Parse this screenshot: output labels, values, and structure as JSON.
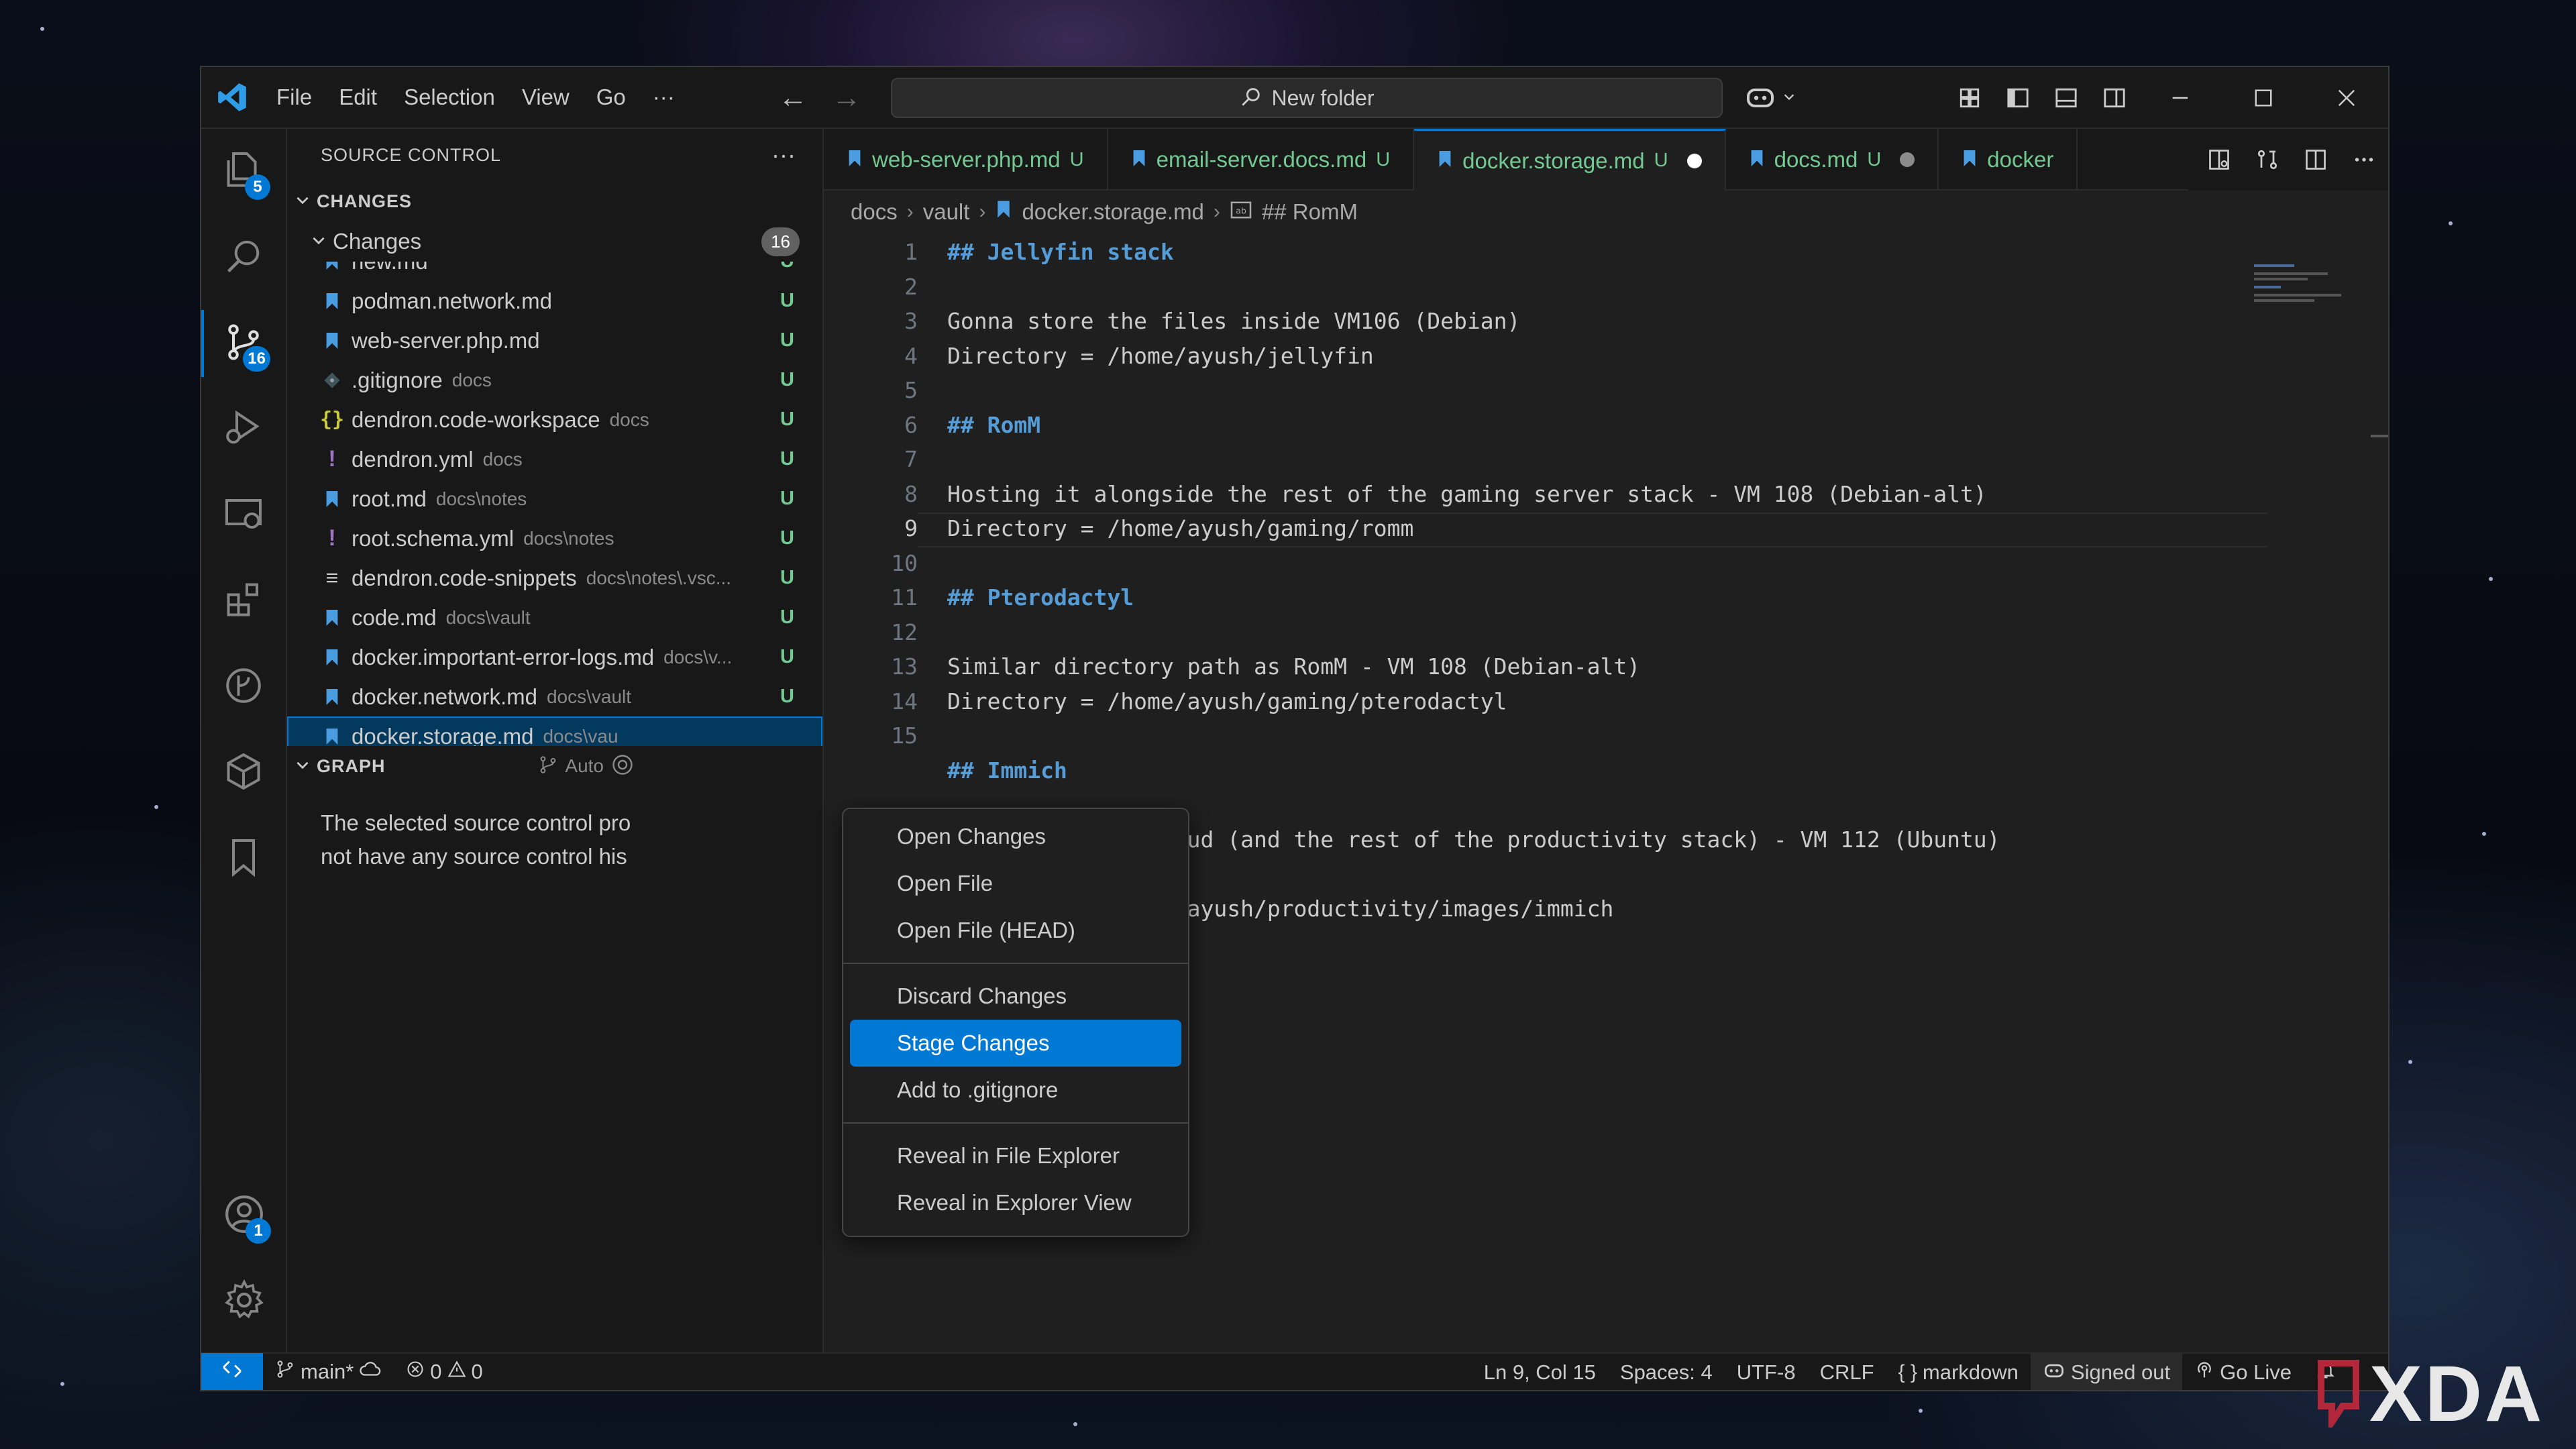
{
  "window": {
    "menu": [
      "File",
      "Edit",
      "Selection",
      "View",
      "Go",
      "···"
    ],
    "nav_back": "←",
    "nav_forward": "→",
    "command_center": "New folder"
  },
  "activity_bar": {
    "explorer_badge": "5",
    "scm_badge": "16",
    "accounts_badge": "1",
    "active": "source-control"
  },
  "sidebar": {
    "title": "SOURCE CONTROL",
    "more": "···",
    "section_changes": "CHANGES",
    "group_label": "Changes",
    "group_count": "16",
    "files": [
      {
        "name": "new.md",
        "path": "",
        "status": "U",
        "icon": "markdown-icon"
      },
      {
        "name": "podman.network.md",
        "path": "",
        "status": "U",
        "icon": "markdown-icon"
      },
      {
        "name": "web-server.php.md",
        "path": "",
        "status": "U",
        "icon": "markdown-icon"
      },
      {
        "name": ".gitignore",
        "path": "docs",
        "status": "U",
        "icon": "git-icon"
      },
      {
        "name": "dendron.code-workspace",
        "path": "docs",
        "status": "U",
        "icon": "json-icon"
      },
      {
        "name": "dendron.yml",
        "path": "docs",
        "status": "U",
        "icon": "yaml-icon"
      },
      {
        "name": "root.md",
        "path": "docs\\notes",
        "status": "U",
        "icon": "markdown-icon"
      },
      {
        "name": "root.schema.yml",
        "path": "docs\\notes",
        "status": "U",
        "icon": "yaml-icon"
      },
      {
        "name": "dendron.code-snippets",
        "path": "docs\\notes\\.vsc...",
        "status": "U",
        "icon": "snippet-icon"
      },
      {
        "name": "code.md",
        "path": "docs\\vault",
        "status": "U",
        "icon": "markdown-icon"
      },
      {
        "name": "docker.important-error-logs.md",
        "path": "docs\\v...",
        "status": "U",
        "icon": "markdown-icon"
      },
      {
        "name": "docker.network.md",
        "path": "docs\\vault",
        "status": "U",
        "icon": "markdown-icon"
      },
      {
        "name": "docker.storage.md",
        "path": "docs\\vau",
        "status": "",
        "icon": "markdown-icon",
        "selected": true
      }
    ],
    "section_graph": "GRAPH",
    "graph_auto": "Auto",
    "graph_message_1": "The selected source control pro",
    "graph_message_2": "not have any source control his"
  },
  "tabs": [
    {
      "name": "web-server.php.md",
      "status": "U",
      "dirty": false,
      "active": false
    },
    {
      "name": "email-server.docs.md",
      "status": "U",
      "dirty": false,
      "active": false
    },
    {
      "name": "docker.storage.md",
      "status": "U",
      "dirty": true,
      "active": true
    },
    {
      "name": "docs.md",
      "status": "U",
      "dirty": true,
      "active": false
    },
    {
      "name": "docker",
      "status": "",
      "dirty": false,
      "active": false
    }
  ],
  "breadcrumb": [
    "docs",
    "vault",
    "docker.storage.md",
    "## RomM"
  ],
  "editor": {
    "current_line": 9,
    "lines": [
      {
        "n": "1",
        "text": "## Jellyfin stack",
        "heading": true
      },
      {
        "n": "2",
        "text": "",
        "heading": false
      },
      {
        "n": "3",
        "text": "Gonna store the files inside VM106 (Debian)",
        "heading": false
      },
      {
        "n": "4",
        "text": "Directory = /home/ayush/jellyfin",
        "heading": false
      },
      {
        "n": "5",
        "text": "",
        "heading": false
      },
      {
        "n": "6",
        "text": "## RomM",
        "heading": true
      },
      {
        "n": "7",
        "text": "",
        "heading": false
      },
      {
        "n": "8",
        "text": "Hosting it alongside the rest of the gaming server stack - VM 108 (Debian-alt)",
        "heading": false
      },
      {
        "n": "9",
        "text": "Directory = /home/ayush/gaming/romm",
        "heading": false
      },
      {
        "n": "10",
        "text": "",
        "heading": false
      },
      {
        "n": "11",
        "text": "## Pterodactyl",
        "heading": true
      },
      {
        "n": "12",
        "text": "",
        "heading": false
      },
      {
        "n": "13",
        "text": "Similar directory path as RomM - VM 108 (Debian-alt)",
        "heading": false
      },
      {
        "n": "14",
        "text": "Directory = /home/ayush/gaming/pterodactyl",
        "heading": false
      },
      {
        "n": "15",
        "text": "",
        "heading": false
      },
      {
        "n": "",
        "text": "## Immich",
        "heading": true
      },
      {
        "n": "",
        "text": "",
        "heading": false
      },
      {
        "n": "",
        "text": "Same VM as Nextcloud (and the rest of the productivity stack) - VM 112 (Ubuntu)",
        "heading": false
      },
      {
        "n": "",
        "text": "",
        "heading": false
      },
      {
        "n": "",
        "text": "Directory = /home/ayush/productivity/images/immich",
        "heading": false
      }
    ]
  },
  "context_menu": {
    "groups": [
      [
        "Open Changes",
        "Open File",
        "Open File (HEAD)"
      ],
      [
        "Discard Changes",
        "Stage Changes",
        "Add to .gitignore"
      ],
      [
        "Reveal in File Explorer",
        "Reveal in Explorer View"
      ]
    ],
    "highlighted": "Stage Changes"
  },
  "status_bar": {
    "branch": "main*",
    "errors": "0",
    "warnings": "0",
    "position": "Ln 9, Col 15",
    "spaces": "Spaces: 4",
    "encoding": "UTF-8",
    "eol": "CRLF",
    "language": "markdown",
    "account": "Signed out",
    "live": "Go Live"
  },
  "watermark": "XDA",
  "colors": {
    "accent": "#0078d4",
    "untracked": "#73c991",
    "heading": "#569cd6",
    "editor_bg": "#1f1f1f",
    "chrome_bg": "#181818"
  }
}
